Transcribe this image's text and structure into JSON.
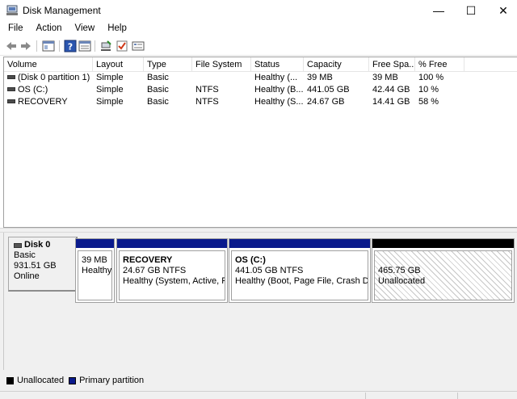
{
  "window": {
    "title": "Disk Management",
    "minimize": "—",
    "maximize": "☐",
    "close": "✕"
  },
  "menu": [
    "File",
    "Action",
    "View",
    "Help"
  ],
  "toolbar": [
    "back-arrow-icon",
    "forward-arrow-icon",
    "console-tree-icon",
    "help-icon",
    "properties-icon",
    "connect-icon",
    "check-icon",
    "settings-icon"
  ],
  "volume_list": {
    "columns": [
      "Volume",
      "Layout",
      "Type",
      "File System",
      "Status",
      "Capacity",
      "Free Spa...",
      "% Free"
    ],
    "rows": [
      [
        "(Disk 0 partition 1)",
        "Simple",
        "Basic",
        "",
        "Healthy (...",
        "39 MB",
        "39 MB",
        "100 %"
      ],
      [
        "OS (C:)",
        "Simple",
        "Basic",
        "NTFS",
        "Healthy (B...",
        "441.05 GB",
        "42.44 GB",
        "10 %"
      ],
      [
        "RECOVERY",
        "Simple",
        "Basic",
        "NTFS",
        "Healthy (S...",
        "24.67 GB",
        "14.41 GB",
        "58 %"
      ]
    ]
  },
  "disk": {
    "name": "Disk 0",
    "type": "Basic",
    "size": "931.51 GB",
    "state": "Online",
    "partitions": [
      {
        "name": "",
        "size": "39 MB",
        "status": "Healthy",
        "kind": "primary"
      },
      {
        "name": "RECOVERY",
        "size": "24.67 GB NTFS",
        "status": "Healthy (System, Active, Prir",
        "kind": "primary"
      },
      {
        "name": "OS  (C:)",
        "size": "441.05 GB NTFS",
        "status": "Healthy (Boot, Page File, Crash Dump",
        "kind": "primary"
      },
      {
        "name": "",
        "size": "465.75 GB",
        "status": "Unallocated",
        "kind": "unallocated"
      }
    ]
  },
  "legend": {
    "unallocated_label": "Unallocated",
    "primary_label": "Primary partition"
  },
  "colors": {
    "primary": "#0a1a8c",
    "unallocated": "#000000"
  }
}
